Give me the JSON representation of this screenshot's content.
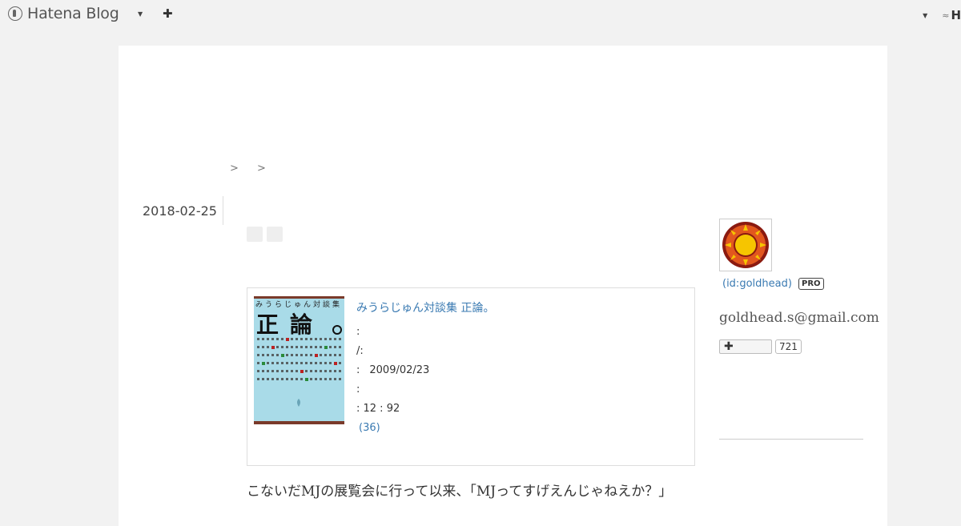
{
  "topbar": {
    "brand": "Hatena Blog",
    "dropdown_icon": "caret-down-icon",
    "new_post_icon": "plus-icon",
    "user_initial": "H"
  },
  "breadcrumb": [
    ">",
    ">"
  ],
  "entry": {
    "date": "2018-02-25",
    "body_first_line": "こないだMJの展覧会に行って以来、「MJってすげえんじゃねえか？」"
  },
  "product": {
    "title": "みうらじゅん対談集 正論。",
    "cover_title": "正論",
    "cover_header": "みうらじゅん対談集",
    "lines": [
      {
        "label": ":",
        "value": ""
      },
      {
        "label": "/:",
        "value": ""
      },
      {
        "label": ":",
        "value": "2009/02/23"
      },
      {
        "label": ":",
        "value": ""
      }
    ],
    "stats_line": ": 12   : 92",
    "reviews": "(36)"
  },
  "sidebar": {
    "profile_id": "(id:goldhead)",
    "pro_badge": "PRO",
    "email": "goldhead.s@gmail.com",
    "follow_icon": "plus-icon",
    "follower_count": "721"
  },
  "colors": {
    "link": "#3a7ab2",
    "page_bg": "#f2f2f2",
    "cover_bg": "#a9dbe8",
    "avatar_red": "#8b1a10",
    "avatar_yellow": "#f6c500"
  }
}
